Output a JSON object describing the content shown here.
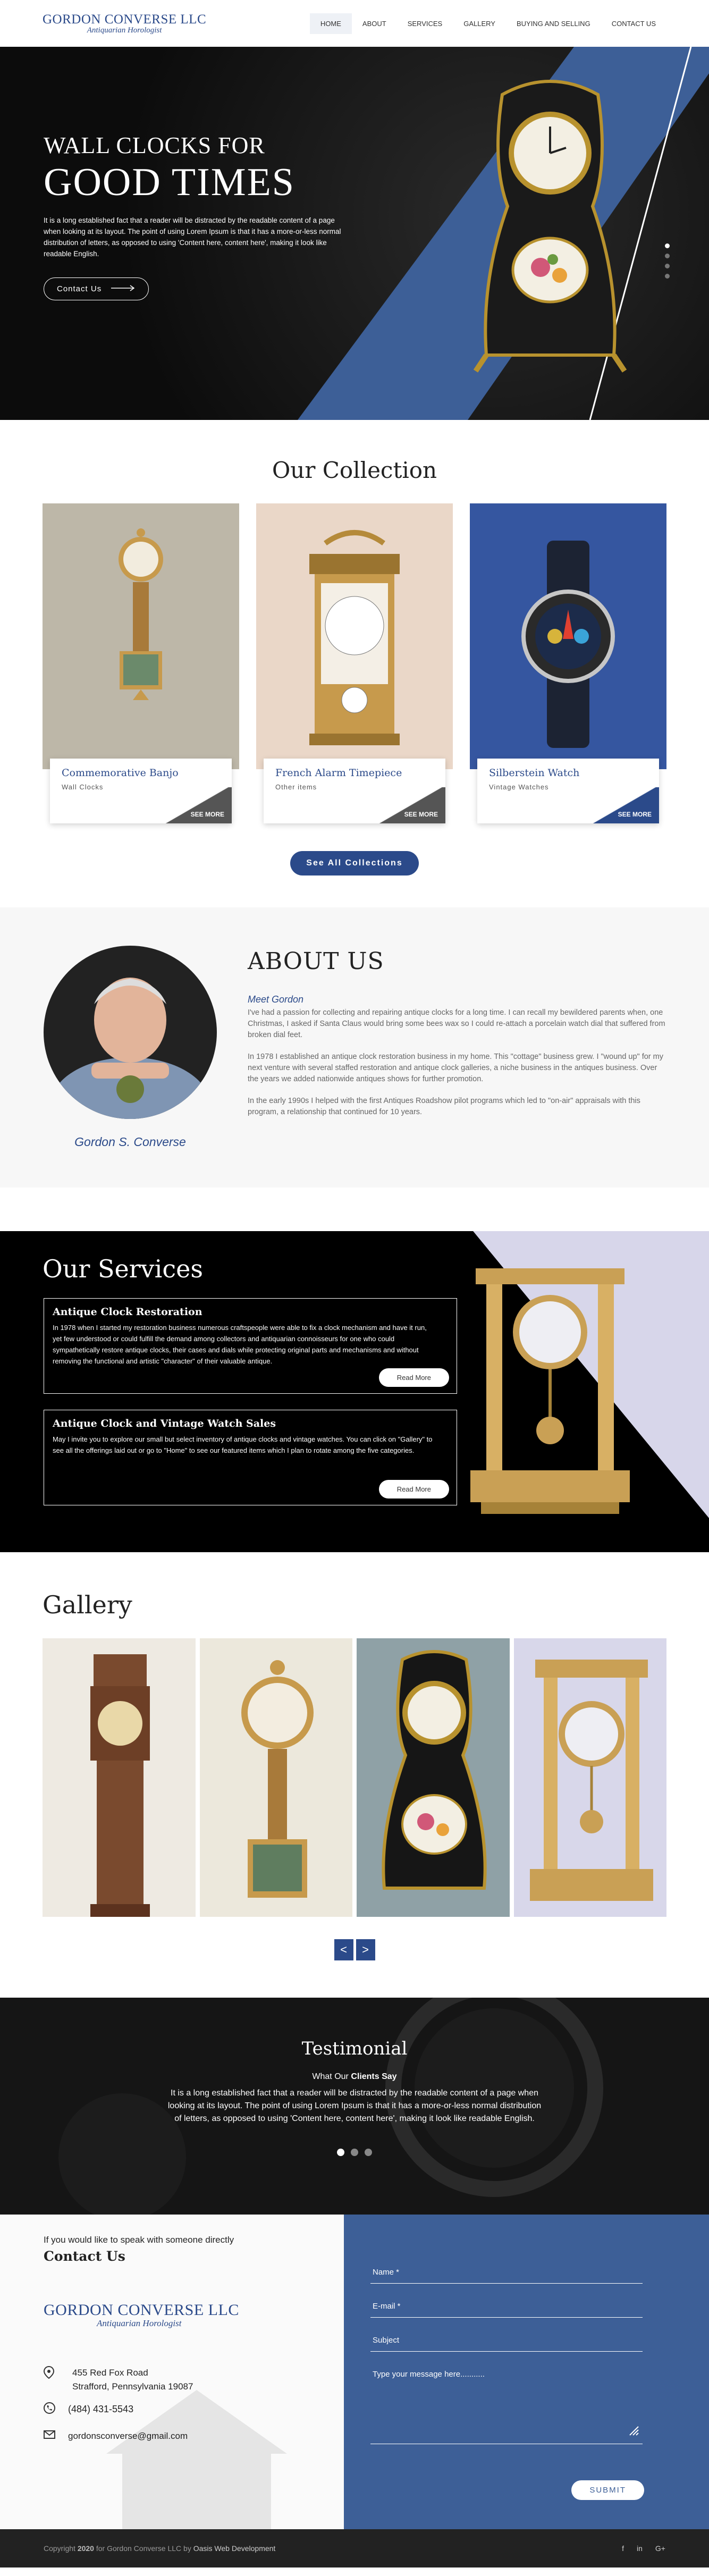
{
  "header": {
    "logo_name": "GORDON CONVERSE LLC",
    "logo_sub": "Antiquarian Horologist",
    "nav": [
      {
        "label": "HOME",
        "active": true
      },
      {
        "label": "ABOUT"
      },
      {
        "label": "SERVICES"
      },
      {
        "label": "GALLERY"
      },
      {
        "label": "BUYING AND SELLING"
      },
      {
        "label": "CONTACT US"
      }
    ]
  },
  "hero": {
    "kicker": "WALL CLOCKS FOR",
    "title": "GOOD TIMES",
    "text": "It is a long established fact that a reader will be distracted by the readable content of a page when looking at its layout. The point of using Lorem Ipsum is that it has a more-or-less normal distribution of letters, as opposed to using 'Content here, content here', making it look like readable English.",
    "button": "Contact Us"
  },
  "collection": {
    "title": "Our Collection",
    "cards": [
      {
        "name": "Commemorative Banjo",
        "category": "Wall Clocks",
        "more": "SEE MORE"
      },
      {
        "name": "French Alarm Timepiece",
        "category": "Other items",
        "more": "SEE MORE"
      },
      {
        "name": "Silberstein Watch",
        "category": "Vintage Watches",
        "more": "SEE MORE"
      }
    ],
    "button": "See All Collections"
  },
  "about": {
    "title": "ABOUT US",
    "person": "Gordon S. Converse",
    "meet": "Meet Gordon",
    "paragraphs": [
      "I've had a passion for collecting and repairing antique clocks for a long time. I can recall my bewildered parents when, one Christmas, I asked if Santa Claus would bring some bees wax so I could re-attach a porcelain watch dial that suffered from broken dial feet.",
      "In 1978 I established an antique clock restoration business in my home. This \"cottage\" business grew. I \"wound up\" for my next venture with several staffed restoration and antique clock galleries, a niche business in the antiques business. Over the years we added nationwide antiques shows for further promotion.",
      "In the early 1990s I helped with the first Antiques Roadshow pilot programs which led to \"on-air\" appraisals with this program, a relationship that continued for 10 years."
    ]
  },
  "services": {
    "title": "Our Services",
    "items": [
      {
        "title": "Antique Clock Restoration",
        "text": "In 1978 when I started my restoration business numerous craftspeople were able to fix a clock mechanism and have it run, yet few understood or could fulfill the demand among collectors and antiquarian connoisseurs for one who could sympathetically restore antique clocks, their cases and dials while protecting original parts and mechanisms and without removing the functional and artistic \"character\" of their valuable antique.",
        "button": "Read More"
      },
      {
        "title": "Antique Clock and Vintage Watch Sales",
        "text": "May I invite you to explore our small but select inventory of antique clocks and vintage watches. You can click on \"Gallery\" to see all the offerings laid out or go to \"Home\" to see our featured items which I plan to rotate among the five categories.",
        "button": "Read More"
      }
    ]
  },
  "gallery": {
    "title": "Gallery",
    "prev": "<",
    "next": ">"
  },
  "testimonial": {
    "title": "Testimonial",
    "what_prefix": "What Our ",
    "what_strong": "Clients Say",
    "text": "It is a long established fact that a reader will be distracted by the readable content of a page when looking at its layout. The point of using Lorem Ipsum is that it has a more-or-less normal distribution of letters, as opposed to using 'Content here, content here', making it look like readable English."
  },
  "contact": {
    "hint": "If you would like to speak with someone directly",
    "title": "Contact Us",
    "address_1": "455 Red Fox Road",
    "address_2": "Strafford, Pennsylvania 19087",
    "phone": "(484) 431-5543",
    "email": "gordonsconverse@gmail.com",
    "form": {
      "name": "Name *",
      "email": "E-mail *",
      "subject": "Subject",
      "message": "Type your message here...........",
      "submit": "SUBMIT"
    }
  },
  "footer": {
    "copy_1": "Copyright ",
    "year": "2020",
    "copy_2": " for Gordon Converse LLC by ",
    "dev": "Oasis Web Development",
    "social": [
      "f",
      "in",
      "G+"
    ]
  },
  "colors": {
    "brand_blue": "#2b4a8a",
    "form_blue": "#3d5f97",
    "dark": "#101010"
  }
}
